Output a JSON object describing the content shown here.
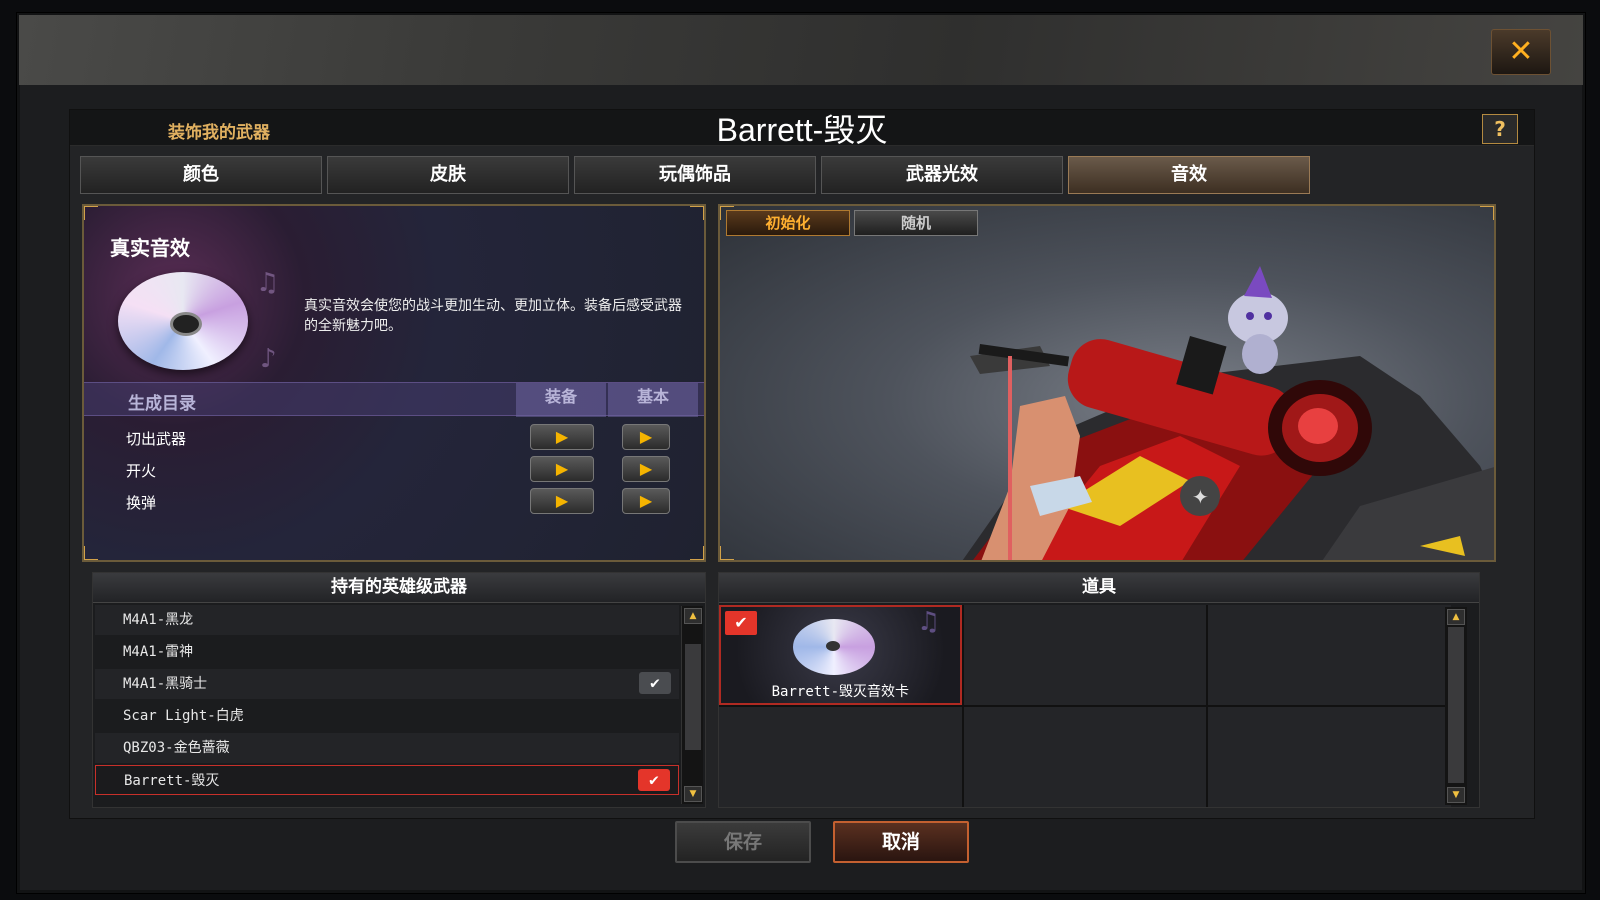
{
  "header": {
    "subtitle": "装饰我的武器",
    "title": "Barrett-毁灭",
    "help": "?"
  },
  "close_icon": "✕",
  "tabs": [
    {
      "label": "颜色",
      "active": false
    },
    {
      "label": "皮肤",
      "active": false
    },
    {
      "label": "玩偶饰品",
      "active": false
    },
    {
      "label": "武器光效",
      "active": false
    },
    {
      "label": "音效",
      "active": true
    }
  ],
  "sound": {
    "title": "真实音效",
    "description": "真实音效会使您的战斗更加生动、更加立体。装备后感受武器的全新魅力吧。",
    "col_name": "生成目录",
    "col_equip": "装备",
    "col_base": "基本",
    "rows": [
      {
        "label": "切出武器"
      },
      {
        "label": "开火"
      },
      {
        "label": "换弹"
      }
    ],
    "play_icon": "▶"
  },
  "preview": {
    "reset_label": "初始化",
    "random_label": "随机"
  },
  "weapons": {
    "header": "持有的英雄级武器",
    "items": [
      {
        "name": "M4A1-黑龙",
        "check": ""
      },
      {
        "name": "M4A1-雷神",
        "check": ""
      },
      {
        "name": "M4A1-黑骑士",
        "check": "✔"
      },
      {
        "name": "Scar Light-白虎",
        "check": ""
      },
      {
        "name": "QBZ03-金色蔷薇",
        "check": ""
      },
      {
        "name": "Barrett-毁灭",
        "check": "✔"
      }
    ]
  },
  "items": {
    "header": "道具",
    "card_label": "Barrett-毁灭音效卡",
    "card_check": "✔"
  },
  "scroll_up": "▲",
  "scroll_down": "▼",
  "buttons": {
    "save": "保存",
    "cancel": "取消"
  }
}
